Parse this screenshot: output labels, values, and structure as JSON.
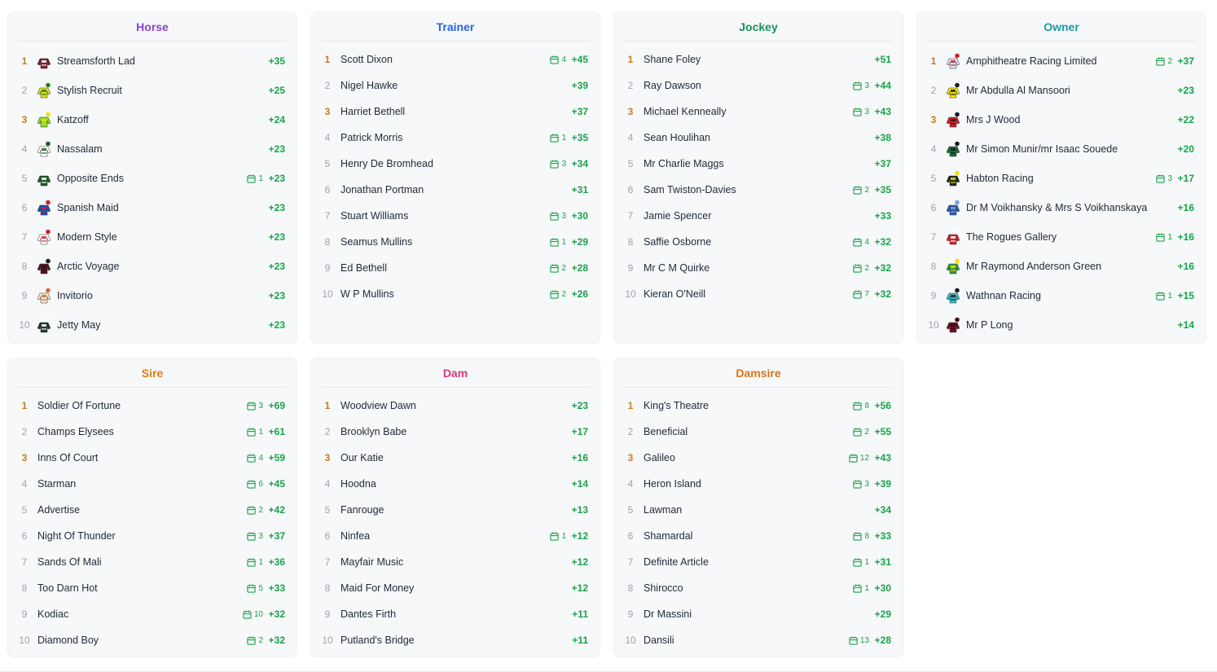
{
  "colors": {
    "horse": "#8b3fd9",
    "trainer": "#2563eb",
    "jockey": "#15935b",
    "owner": "#1a9aa8",
    "sire": "#e07b14",
    "dam": "#d43b7a",
    "damsire": "#d97315",
    "score": "#16a34a",
    "rank_top": "#c77c18",
    "rank": "#9ca3af"
  },
  "panels": [
    {
      "key": "horse",
      "title": "Horse",
      "compact": false,
      "silks": true,
      "rows": [
        {
          "rank": "1",
          "name": "Streamsforth Lad",
          "cal": "",
          "score": "+35",
          "silk": [
            "#7a1e2c",
            "#ffffff"
          ]
        },
        {
          "rank": "2",
          "name": "Stylish Recruit",
          "cal": "",
          "score": "+25",
          "silk": [
            "#d6e021",
            "#2a7a2a"
          ]
        },
        {
          "rank": "3",
          "name": "Katzoff",
          "cal": "",
          "score": "+24",
          "silk": [
            "#8cd62b",
            "#e6e600"
          ]
        },
        {
          "rank": "4",
          "name": "Nassalam",
          "cal": "",
          "score": "+23",
          "silk": [
            "#ffffff",
            "#1f5a2a"
          ]
        },
        {
          "rank": "5",
          "name": "Opposite Ends",
          "cal": "1",
          "score": "+23",
          "silk": [
            "#1f5a2a",
            "#ffffff"
          ]
        },
        {
          "rank": "6",
          "name": "Spanish Maid",
          "cal": "",
          "score": "+23",
          "silk": [
            "#1d4fb0",
            "#d21f2a"
          ]
        },
        {
          "rank": "7",
          "name": "Modern Style",
          "cal": "",
          "score": "+23",
          "silk": [
            "#ffffff",
            "#d21f2a"
          ]
        },
        {
          "rank": "8",
          "name": "Arctic Voyage",
          "cal": "",
          "score": "+23",
          "silk": [
            "#5a1020",
            "#1a1a1a"
          ]
        },
        {
          "rank": "9",
          "name": "Invitorio",
          "cal": "",
          "score": "+23",
          "silk": [
            "#f4e6d8",
            "#d86a2a"
          ]
        },
        {
          "rank": "10",
          "name": "Jetty May",
          "cal": "",
          "score": "+23",
          "silk": [
            "#1a3a2a",
            "#ffffff"
          ]
        }
      ]
    },
    {
      "key": "trainer",
      "title": "Trainer",
      "compact": true,
      "silks": false,
      "rows": [
        {
          "rank": "1",
          "name": "Scott Dixon",
          "cal": "4",
          "score": "+45"
        },
        {
          "rank": "2",
          "name": "Nigel Hawke",
          "cal": "",
          "score": "+39"
        },
        {
          "rank": "3",
          "name": "Harriet Bethell",
          "cal": "",
          "score": "+37"
        },
        {
          "rank": "4",
          "name": "Patrick Morris",
          "cal": "1",
          "score": "+35"
        },
        {
          "rank": "5",
          "name": "Henry De Bromhead",
          "cal": "3",
          "score": "+34"
        },
        {
          "rank": "6",
          "name": "Jonathan Portman",
          "cal": "",
          "score": "+31"
        },
        {
          "rank": "7",
          "name": "Stuart Williams",
          "cal": "3",
          "score": "+30"
        },
        {
          "rank": "8",
          "name": "Seamus Mullins",
          "cal": "1",
          "score": "+29"
        },
        {
          "rank": "9",
          "name": "Ed Bethell",
          "cal": "2",
          "score": "+28"
        },
        {
          "rank": "10",
          "name": "W P Mullins",
          "cal": "2",
          "score": "+26"
        }
      ]
    },
    {
      "key": "jockey",
      "title": "Jockey",
      "compact": true,
      "silks": false,
      "rows": [
        {
          "rank": "1",
          "name": "Shane Foley",
          "cal": "",
          "score": "+51"
        },
        {
          "rank": "2",
          "name": "Ray Dawson",
          "cal": "3",
          "score": "+44"
        },
        {
          "rank": "3",
          "name": "Michael Kenneally",
          "cal": "3",
          "score": "+43"
        },
        {
          "rank": "4",
          "name": "Sean Houlihan",
          "cal": "",
          "score": "+38"
        },
        {
          "rank": "5",
          "name": "Mr Charlie Maggs",
          "cal": "",
          "score": "+37"
        },
        {
          "rank": "6",
          "name": "Sam Twiston-Davies",
          "cal": "2",
          "score": "+35"
        },
        {
          "rank": "7",
          "name": "Jamie Spencer",
          "cal": "",
          "score": "+33"
        },
        {
          "rank": "8",
          "name": "Saffie Osborne",
          "cal": "4",
          "score": "+32"
        },
        {
          "rank": "9",
          "name": "Mr C M Quirke",
          "cal": "2",
          "score": "+32"
        },
        {
          "rank": "10",
          "name": "Kieran O'Neill",
          "cal": "7",
          "score": "+32"
        }
      ]
    },
    {
      "key": "owner",
      "title": "Owner",
      "compact": false,
      "silks": true,
      "rows": [
        {
          "rank": "1",
          "name": "Amphitheatre Racing Limited",
          "cal": "2",
          "score": "+37",
          "silk": [
            "#d9e6f5",
            "#d21f2a"
          ]
        },
        {
          "rank": "2",
          "name": "Mr Abdulla Al Mansoori",
          "cal": "",
          "score": "+23",
          "silk": [
            "#f2e100",
            "#1a1a1a"
          ]
        },
        {
          "rank": "3",
          "name": "Mrs J Wood",
          "cal": "",
          "score": "+22",
          "silk": [
            "#d21f2a",
            "#1a1a1a"
          ]
        },
        {
          "rank": "4",
          "name": "Mr Simon Munir/mr Isaac Souede",
          "cal": "",
          "score": "+20",
          "silk": [
            "#1a6a3a",
            "#1a1a1a"
          ]
        },
        {
          "rank": "5",
          "name": "Habton Racing",
          "cal": "3",
          "score": "+17",
          "silk": [
            "#1a2a1a",
            "#f2e100"
          ]
        },
        {
          "rank": "6",
          "name": "Dr M Voikhansky & Mrs S Voikhanskaya",
          "cal": "",
          "score": "+16",
          "silk": [
            "#2a5ab0",
            "#7aa0d8"
          ]
        },
        {
          "rank": "7",
          "name": "The Rogues Gallery",
          "cal": "1",
          "score": "+16",
          "silk": [
            "#d21f2a",
            "#ffffff"
          ]
        },
        {
          "rank": "8",
          "name": "Mr Raymond Anderson Green",
          "cal": "",
          "score": "+16",
          "silk": [
            "#2a9a3a",
            "#f2e100"
          ]
        },
        {
          "rank": "9",
          "name": "Wathnan Racing",
          "cal": "1",
          "score": "+15",
          "silk": [
            "#3ab8c8",
            "#1a1a1a"
          ]
        },
        {
          "rank": "10",
          "name": "Mr P Long",
          "cal": "",
          "score": "+14",
          "silk": [
            "#6a1020",
            "#3a0a10"
          ]
        }
      ]
    },
    {
      "key": "sire",
      "title": "Sire",
      "compact": true,
      "silks": false,
      "rows": [
        {
          "rank": "1",
          "name": "Soldier Of Fortune",
          "cal": "3",
          "score": "+69"
        },
        {
          "rank": "2",
          "name": "Champs Elysees",
          "cal": "1",
          "score": "+61"
        },
        {
          "rank": "3",
          "name": "Inns Of Court",
          "cal": "4",
          "score": "+59"
        },
        {
          "rank": "4",
          "name": "Starman",
          "cal": "6",
          "score": "+45"
        },
        {
          "rank": "5",
          "name": "Advertise",
          "cal": "2",
          "score": "+42"
        },
        {
          "rank": "6",
          "name": "Night Of Thunder",
          "cal": "3",
          "score": "+37"
        },
        {
          "rank": "7",
          "name": "Sands Of Mali",
          "cal": "1",
          "score": "+36"
        },
        {
          "rank": "8",
          "name": "Too Darn Hot",
          "cal": "5",
          "score": "+33"
        },
        {
          "rank": "9",
          "name": "Kodiac",
          "cal": "10",
          "score": "+32"
        },
        {
          "rank": "10",
          "name": "Diamond Boy",
          "cal": "2",
          "score": "+32"
        }
      ]
    },
    {
      "key": "dam",
      "title": "Dam",
      "compact": true,
      "silks": false,
      "rows": [
        {
          "rank": "1",
          "name": "Woodview Dawn",
          "cal": "",
          "score": "+23"
        },
        {
          "rank": "2",
          "name": "Brooklyn Babe",
          "cal": "",
          "score": "+17"
        },
        {
          "rank": "3",
          "name": "Our Katie",
          "cal": "",
          "score": "+16"
        },
        {
          "rank": "4",
          "name": "Hoodna",
          "cal": "",
          "score": "+14"
        },
        {
          "rank": "5",
          "name": "Fanrouge",
          "cal": "",
          "score": "+13"
        },
        {
          "rank": "6",
          "name": "Ninfea",
          "cal": "1",
          "score": "+12"
        },
        {
          "rank": "7",
          "name": "Mayfair Music",
          "cal": "",
          "score": "+12"
        },
        {
          "rank": "8",
          "name": "Maid For Money",
          "cal": "",
          "score": "+12"
        },
        {
          "rank": "9",
          "name": "Dantes Firth",
          "cal": "",
          "score": "+11"
        },
        {
          "rank": "10",
          "name": "Putland's Bridge",
          "cal": "",
          "score": "+11"
        }
      ]
    },
    {
      "key": "damsire",
      "title": "Damsire",
      "compact": true,
      "silks": false,
      "rows": [
        {
          "rank": "1",
          "name": "King's Theatre",
          "cal": "8",
          "score": "+56"
        },
        {
          "rank": "2",
          "name": "Beneficial",
          "cal": "2",
          "score": "+55"
        },
        {
          "rank": "3",
          "name": "Galileo",
          "cal": "12",
          "score": "+43"
        },
        {
          "rank": "4",
          "name": "Heron Island",
          "cal": "3",
          "score": "+39"
        },
        {
          "rank": "5",
          "name": "Lawman",
          "cal": "",
          "score": "+34"
        },
        {
          "rank": "6",
          "name": "Shamardal",
          "cal": "8",
          "score": "+33"
        },
        {
          "rank": "7",
          "name": "Definite Article",
          "cal": "1",
          "score": "+31"
        },
        {
          "rank": "8",
          "name": "Shirocco",
          "cal": "1",
          "score": "+30"
        },
        {
          "rank": "9",
          "name": "Dr Massini",
          "cal": "",
          "score": "+29"
        },
        {
          "rank": "10",
          "name": "Dansili",
          "cal": "13",
          "score": "+28"
        }
      ]
    }
  ]
}
